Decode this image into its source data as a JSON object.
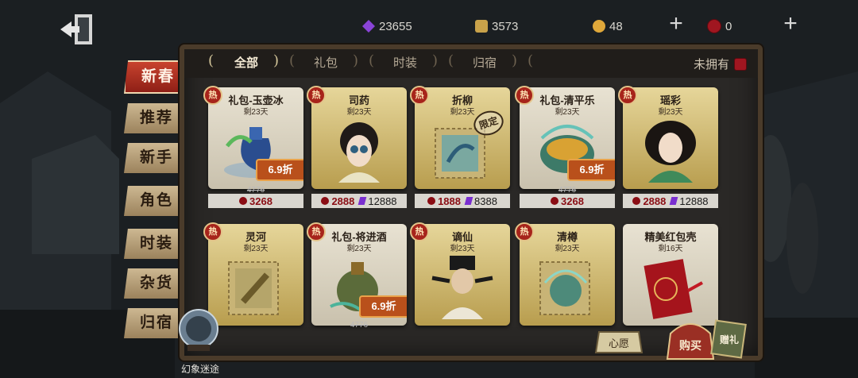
{
  "currencies": {
    "purple": "23655",
    "puzzle": "3573",
    "gold": "48",
    "red": "0"
  },
  "tabs": [
    {
      "label": "全部",
      "active": true
    },
    {
      "label": "礼包"
    },
    {
      "label": "时装"
    },
    {
      "label": "归宿"
    }
  ],
  "owned_filter_label": "未拥有",
  "side_tabs": [
    "新春",
    "推荐",
    "新手",
    "角色",
    "时装",
    "杂货",
    "归宿"
  ],
  "hot_label": "热",
  "items_row1": [
    {
      "name": "礼包-玉壶冰",
      "remain": "剩23天",
      "discount": "6.9折",
      "old_price": "4776",
      "price_red": "3268"
    },
    {
      "name": "司药",
      "remain": "剩23天",
      "price_red": "2888",
      "price_purple": "12888"
    },
    {
      "name": "折柳",
      "remain": "剩23天",
      "tag": "限定",
      "price_red": "1888",
      "price_purple": "8388"
    },
    {
      "name": "礼包-清平乐",
      "remain": "剩23天",
      "discount": "6.9折",
      "old_price": "4776",
      "price_red": "3268"
    },
    {
      "name": "瑶彩",
      "remain": "剩23天",
      "price_red": "2888",
      "price_purple": "12888"
    }
  ],
  "items_row2": [
    {
      "name": "灵河",
      "remain": "剩23天"
    },
    {
      "name": "礼包-将进酒",
      "remain": "剩23天",
      "discount": "6.9折",
      "old_price": "4776"
    },
    {
      "name": "谪仙",
      "remain": "剩23天"
    },
    {
      "name": "清樽",
      "remain": "剩23天"
    },
    {
      "name": "精美红包壳",
      "remain": "剩16天"
    }
  ],
  "bottom": {
    "dream_label": "幻象迷途",
    "wish_label": "心愿",
    "buy_label": "购买",
    "gift_label": "赠礼"
  },
  "colors": {
    "accent_red": "#a7241b",
    "panel_border": "#4a3b2a",
    "card_gold": "#e6d69a"
  }
}
